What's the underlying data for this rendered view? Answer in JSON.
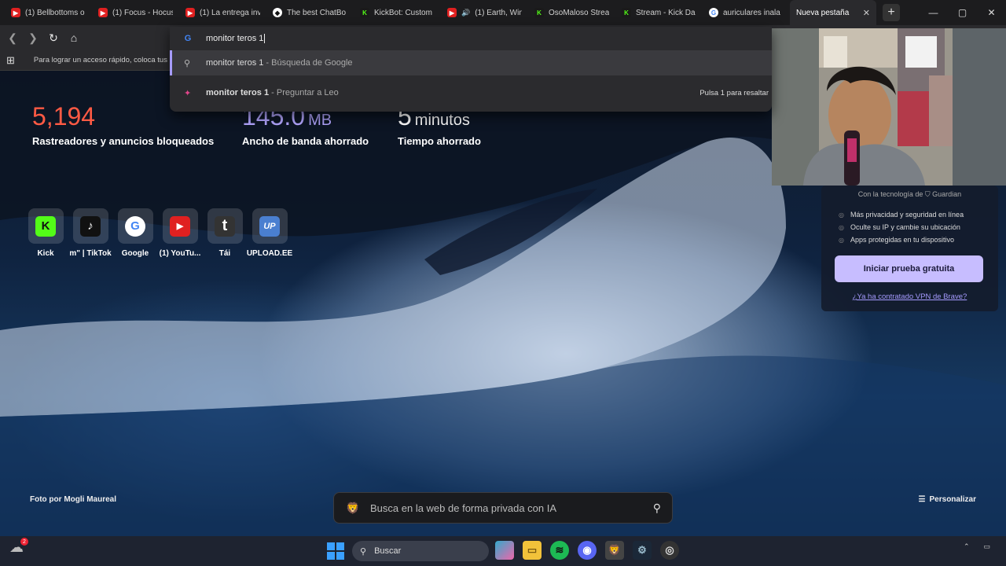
{
  "tabs": [
    {
      "title": "(1) Bellbottoms o",
      "icon": "youtube-icon"
    },
    {
      "title": "(1) Focus - Hocus",
      "icon": "youtube-icon"
    },
    {
      "title": "(1) La entrega inv",
      "icon": "youtube-icon"
    },
    {
      "title": "The best ChatBo",
      "icon": "chatbot-icon"
    },
    {
      "title": "KickBot: Custom",
      "icon": "kick-icon"
    },
    {
      "title": "(1) Earth, Win",
      "icon": "youtube-icon"
    },
    {
      "title": "OsoMaloso Strea",
      "icon": "kick-icon"
    },
    {
      "title": "Stream - Kick Da",
      "icon": "kick-icon"
    },
    {
      "title": "auriculares inala",
      "icon": "google-icon"
    },
    {
      "title": "Nueva pestaña",
      "icon": "",
      "active": true
    }
  ],
  "bookmarks_bar": {
    "hint": "Para lograr un acceso rápido, coloca tus"
  },
  "omnibox": {
    "query": "monitor teros 1",
    "suggestions": [
      {
        "main": "monitor teros 1",
        "sub": " - Búsqueda de Google",
        "icon": "search-icon"
      },
      {
        "main": "monitor teros 1",
        "sub": " - Preguntar a Leo",
        "icon": "leo-icon",
        "hint": "Pulsa 1 para resaltar"
      }
    ]
  },
  "stats": [
    {
      "value": "5,194",
      "unit": "",
      "label": "Rastreadores y anuncios bloqueados"
    },
    {
      "value": "145.0",
      "unit": "MB",
      "label": "Ancho de banda ahorrado"
    },
    {
      "value": "5",
      "unit": "minutos",
      "label": "Tiempo ahorrado"
    }
  ],
  "top_sites": [
    {
      "name": "Kick",
      "icon": "kick-icon"
    },
    {
      "name": "m\" | TikTok",
      "icon": "tiktok-icon"
    },
    {
      "name": "Google",
      "icon": "google-icon"
    },
    {
      "name": "(1) YouTu...",
      "icon": "youtube-icon"
    },
    {
      "name": "Tái",
      "icon": "t-icon"
    },
    {
      "name": "UPLOAD.EE",
      "icon": "upload-icon"
    }
  ],
  "vpn": {
    "tech": "Con la tecnología de",
    "brand": "Guardian",
    "features": [
      "Más privacidad y seguridad en línea",
      "Oculte su IP y cambie su ubicación",
      "Apps protegidas en tu dispositivo"
    ],
    "cta": "Iniciar prueba gratuita",
    "link": "¿Ya ha contratado VPN de Brave?"
  },
  "photo_credit": "Foto por Mogli Maureal",
  "search": {
    "placeholder": "Busca en la web de forma privada con IA"
  },
  "personalize": "Personalizar",
  "taskbar": {
    "search": "Buscar",
    "weather_badge": "2"
  },
  "colors": {
    "stat_red": "#ff5a44",
    "stat_purple": "#b3a6ff",
    "vpn_cta": "#c7bdff",
    "kick_green": "#53fc18"
  }
}
